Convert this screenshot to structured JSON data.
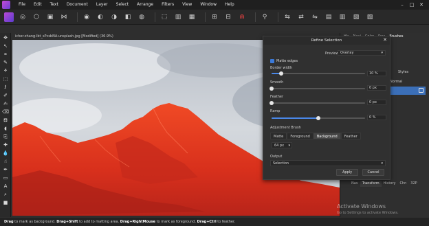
{
  "menu": [
    "File",
    "Edit",
    "Text",
    "Document",
    "Layer",
    "Select",
    "Arrange",
    "Filters",
    "View",
    "Window",
    "Help"
  ],
  "document_tab": "icher-zhang-lbt_sPcsbNA-unsplash.jpg [Modified] (36.9%)",
  "right_panel": {
    "tabs": [
      "His",
      "Navi",
      "Color",
      "Swa",
      "Brushes"
    ],
    "styles_label": "Styles",
    "blend_mode": "Normal",
    "bottom_tabs": [
      "Nav",
      "Transform",
      "History",
      "Chn",
      "32P"
    ]
  },
  "dialog": {
    "title": "Refine Selection",
    "preview_label": "Preview",
    "preview_value": "Overlay",
    "matte_edges_label": "Matte edges",
    "matte_edges_checked": true,
    "sliders": [
      {
        "label": "Border width",
        "value": "10 %",
        "fraction": 0.1
      },
      {
        "label": "Smooth",
        "value": "0 px",
        "fraction": 0.0
      },
      {
        "label": "Feather",
        "value": "0 px",
        "fraction": 0.0
      },
      {
        "label": "Ramp",
        "value": "0 %",
        "fraction": 0.5
      }
    ],
    "adjustment_brush_label": "Adjustment Brush",
    "brush_modes": [
      "Matte",
      "Foreground",
      "Background",
      "Feather"
    ],
    "active_brush_mode": "Background",
    "brush_size": "64 px",
    "output_label": "Output",
    "output_value": "Selection",
    "apply_label": "Apply",
    "cancel_label": "Cancel"
  },
  "watermark": {
    "title": "Activate Windows",
    "subtitle": "Go to Settings to activate Windows."
  },
  "statusbar": {
    "t1": "Drag",
    "t2": " to mark as background. ",
    "t3": "Drag+Shift",
    "t4": " to add to matting area. ",
    "t5": "Drag+RightMouse",
    "t6": " to mark as foreground. ",
    "t7": "Drag+Ctrl",
    "t8": " to feather."
  },
  "colors": {
    "accent": "#3b7ad9",
    "overlay_red": "#e0321e",
    "layer_selected": "#3b6fb8"
  }
}
